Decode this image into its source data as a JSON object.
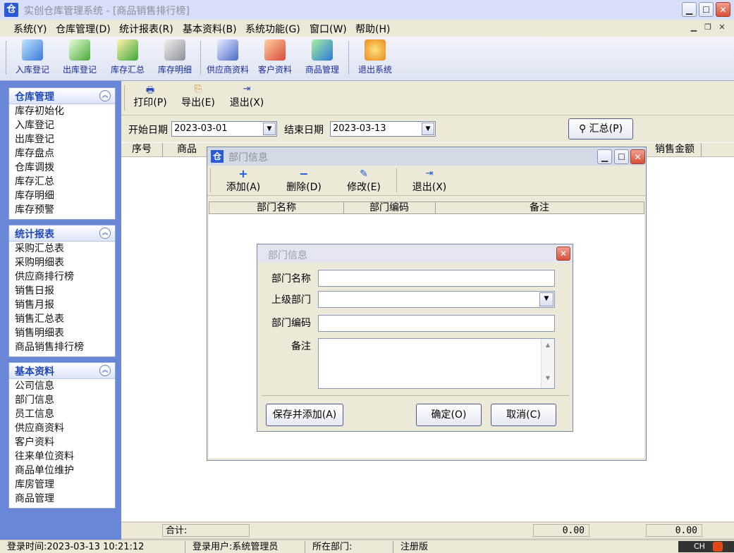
{
  "window": {
    "title": "实创仓库管理系统 - [商品销售排行榜]",
    "app_icon": "仓"
  },
  "menu": [
    "系统(Y)",
    "仓库管理(D)",
    "统计报表(R)",
    "基本资料(B)",
    "系统功能(G)",
    "窗口(W)",
    "帮助(H)"
  ],
  "toolbar": [
    {
      "label": "入库登记",
      "icon": "inbound-icon"
    },
    {
      "label": "出库登记",
      "icon": "outbound-icon"
    },
    {
      "label": "库存汇总",
      "icon": "stock-summary-icon"
    },
    {
      "label": "库存明细",
      "icon": "stock-detail-icon"
    },
    {
      "label": "供应商资料",
      "icon": "supplier-icon"
    },
    {
      "label": "客户资料",
      "icon": "customer-icon"
    },
    {
      "label": "商品管理",
      "icon": "product-icon"
    },
    {
      "label": "退出系统",
      "icon": "exit-icon"
    }
  ],
  "sidebar": {
    "warehouse": {
      "title": "仓库管理",
      "items": [
        "库存初始化",
        "入库登记",
        "出库登记",
        "库存盘点",
        "仓库调拨",
        "库存汇总",
        "库存明细",
        "库存预警"
      ]
    },
    "reports": {
      "title": "统计报表",
      "items": [
        "采购汇总表",
        "采购明细表",
        "供应商排行榜",
        "销售日报",
        "销售月报",
        "销售汇总表",
        "销售明细表",
        "商品销售排行榜"
      ]
    },
    "basic": {
      "title": "基本资料",
      "items": [
        "公司信息",
        "部门信息",
        "员工信息",
        "供应商资料",
        "客户资料",
        "往来单位资料",
        "商品单位维护",
        "库房管理",
        "商品管理"
      ]
    }
  },
  "report": {
    "print": "打印(P)",
    "export": "导出(E)",
    "exit": "退出(X)",
    "start_label": "开始日期",
    "start_date": "2023-03-01",
    "end_label": "结束日期",
    "end_date": "2023-03-13",
    "summary_button": "汇总(P)",
    "col_seq": "序号",
    "col_product": "商品",
    "col_amount": "销售金额",
    "total_label": "合计:",
    "total_qty": "0.00",
    "total_amount": "0.00"
  },
  "dept_window": {
    "title": "部门信息",
    "add": "添加(A)",
    "delete": "删除(D)",
    "edit": "修改(E)",
    "exit": "退出(X)",
    "col_name": "部门名称",
    "col_code": "部门编码",
    "col_remark": "备注"
  },
  "dept_dialog": {
    "title": "部门信息",
    "name_label": "部门名称",
    "parent_label": "上级部门",
    "code_label": "部门编码",
    "remark_label": "备注",
    "save_add": "保存并添加(A)",
    "ok": "确定(O)",
    "cancel": "取消(C)"
  },
  "status": {
    "login_time": "登录时间:2023-03-13 10:21:12",
    "login_user": "登录用户:系统管理员",
    "department": "所在部门:",
    "edition": "注册版",
    "ime": "CH"
  }
}
